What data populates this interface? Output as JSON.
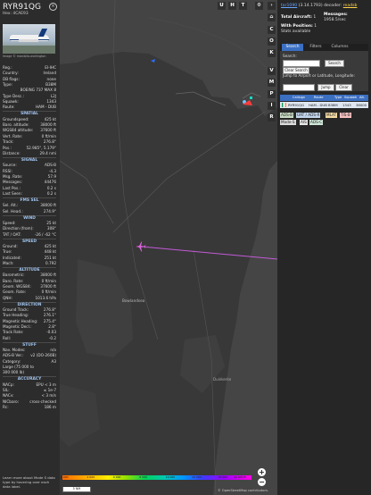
{
  "aircraft": {
    "callsign": "RYR91QG",
    "hex_label": "Hex:",
    "hex": "4CAE93",
    "photo_credit": "Image © marcbila.warlington",
    "fields": [
      {
        "k": "Reg.:",
        "v": "EI-IHC"
      },
      {
        "k": "Country:",
        "v": "Ireland"
      },
      {
        "k": "DB flags:",
        "v": "none"
      },
      {
        "k": "Type:",
        "v": "B38M"
      },
      {
        "k": "",
        "v": "BOEING 737 MAX 8"
      },
      {
        "k": "Type Desc.:",
        "v": "L2J"
      },
      {
        "k": "Squawk:",
        "v": "1343"
      },
      {
        "k": "Route:",
        "v": "HAM - DUB"
      }
    ],
    "sections": [
      {
        "title": "SPATIAL",
        "rows": [
          {
            "k": "Groundspeed:",
            "v": "425 kt"
          },
          {
            "k": "Baro. altitude:",
            "v": "38000 ft"
          },
          {
            "k": "WGS84 altitude:",
            "v": "37600 ft"
          },
          {
            "k": "Vert. Rate:",
            "v": "0 ft/min"
          },
          {
            "k": "Track:",
            "v": "276.8°"
          },
          {
            "k": "Pos.:",
            "v": "52.985°, 5.179°"
          },
          {
            "k": "Distance:",
            "v": "29.4 nmi"
          }
        ]
      },
      {
        "title": "SIGNAL",
        "rows": [
          {
            "k": "Source:",
            "v": "ADS-B"
          },
          {
            "k": "RSSI:",
            "v": "-4.3"
          },
          {
            "k": "Msg. Rate:",
            "v": "57.9"
          },
          {
            "k": "Messages:",
            "v": "44476"
          },
          {
            "k": "Last Pos.:",
            "v": "0.2 s"
          },
          {
            "k": "Last Seen:",
            "v": "0.2 s"
          }
        ]
      },
      {
        "title": "FMS SEL",
        "rows": [
          {
            "k": "Sel. Alt.:",
            "v": "38000 ft"
          },
          {
            "k": "Sel. Head.:",
            "v": "274.9°"
          }
        ]
      },
      {
        "title": "WIND",
        "rows": [
          {
            "k": "Speed:",
            "v": "25 kt"
          },
          {
            "k": "Direction (from):",
            "v": "308°"
          },
          {
            "k": "TAT / OAT:",
            "v": "-26 / -62 °C"
          }
        ]
      },
      {
        "title": "SPEED",
        "rows": [
          {
            "k": "Ground:",
            "v": "425 kt"
          },
          {
            "k": "True:",
            "v": "448 kt"
          },
          {
            "k": "Indicated:",
            "v": "251 kt"
          },
          {
            "k": "Mach:",
            "v": "0.792"
          }
        ]
      },
      {
        "title": "ALTITUDE",
        "rows": [
          {
            "k": "Barometric:",
            "v": "38000 ft"
          },
          {
            "k": "Baro. Rate:",
            "v": "0 ft/min"
          },
          {
            "k": "Geom. WGS84:",
            "v": "37600 ft"
          },
          {
            "k": "Geom. Rate:",
            "v": "0 ft/min"
          },
          {
            "k": "QNH:",
            "v": "1013.6 hPa"
          }
        ]
      },
      {
        "title": "DIRECTION",
        "rows": [
          {
            "k": "Ground Track:",
            "v": "276.8°"
          },
          {
            "k": "True Heading:",
            "v": "276.1°"
          },
          {
            "k": "Magnetic Heading:",
            "v": "275.4°"
          },
          {
            "k": "Magnetic Decl.:",
            "v": "2.8°"
          },
          {
            "k": "Track Rate:",
            "v": "-0.03"
          },
          {
            "k": "Roll:",
            "v": "-0.2"
          }
        ]
      },
      {
        "title": "STUFF",
        "rows": [
          {
            "k": "Nav. Modes:",
            "v": "n/a"
          },
          {
            "k": "ADS-B Ver.:",
            "v": "v2 (DO-260B)"
          },
          {
            "k": "Category:",
            "v": "A3"
          },
          {
            "k": "Large (75 000 to",
            "v": ""
          },
          {
            "k": "300 000 lb)",
            "v": ""
          }
        ]
      },
      {
        "title": "ACCURACY",
        "rows": [
          {
            "k": "NACp:",
            "v": "EPU < 3 m"
          },
          {
            "k": "SIL:",
            "v": "≤ 1e-7"
          },
          {
            "k": "NACv:",
            "v": "< 3 m/s"
          },
          {
            "k": "NICbaro:",
            "v": "cross-checked"
          },
          {
            "k": "Rc:",
            "v": "186 m"
          }
        ]
      }
    ],
    "footer": "Learn more about Mode S data type by hovering over each data label."
  },
  "map": {
    "top_buttons": [
      "U",
      "H",
      "T"
    ],
    "side_buttons": [
      "C",
      "O",
      "K",
      "V",
      "M",
      "P",
      "I",
      "R"
    ],
    "region_label": "Bowlandsea",
    "place_label": "Duinkerke",
    "zoom_in": "+",
    "zoom_out": "−",
    "colorbar_ticks": [
      "2 000",
      "4 000",
      "6 000",
      "8 000",
      "10 000",
      "20 000",
      "30 000",
      "40 000 ft"
    ],
    "scale_label": "5 NM",
    "attribution": "© OpenStreetMap contributors."
  },
  "panel": {
    "app_link": "tar1090",
    "app_version": "(3.14.1793)",
    "decoder_label": "decoder:",
    "decoder_link": "readsb",
    "total_aircraft_label": "Total Aircraft:",
    "total_aircraft": "1",
    "messages_label": "Messages:",
    "messages_rate": "1958.5/sec",
    "with_position_label": "With Position:",
    "with_position": "1",
    "stats_available": "Stats available",
    "tabs": [
      "Search",
      "Filters",
      "Columns"
    ],
    "search_label": "Search:",
    "search_button": "Search",
    "clear_search": "Clear Search",
    "jump_label": "Jump to Airport or Latitude, Longitude:",
    "jump_button": "Jump",
    "clear_button": "Clear",
    "table_headers": [
      "Callsign",
      "Route",
      "Type",
      "Squawk",
      "Alt."
    ],
    "table_rows": [
      [
        "RYR91QG",
        "HAM - DUB",
        "B38M",
        "1343",
        "38000"
      ]
    ],
    "badges": [
      "ADS-B",
      "UAT / ADS-R",
      "MLAT",
      "TIS-B",
      "Mode-S",
      "AIS",
      "ADS-C"
    ]
  },
  "colors": {
    "accent": "#3b6fc2",
    "track": "#c35bd9",
    "aircraft": "#d966d9",
    "land": "#454545",
    "water": "#383838"
  }
}
